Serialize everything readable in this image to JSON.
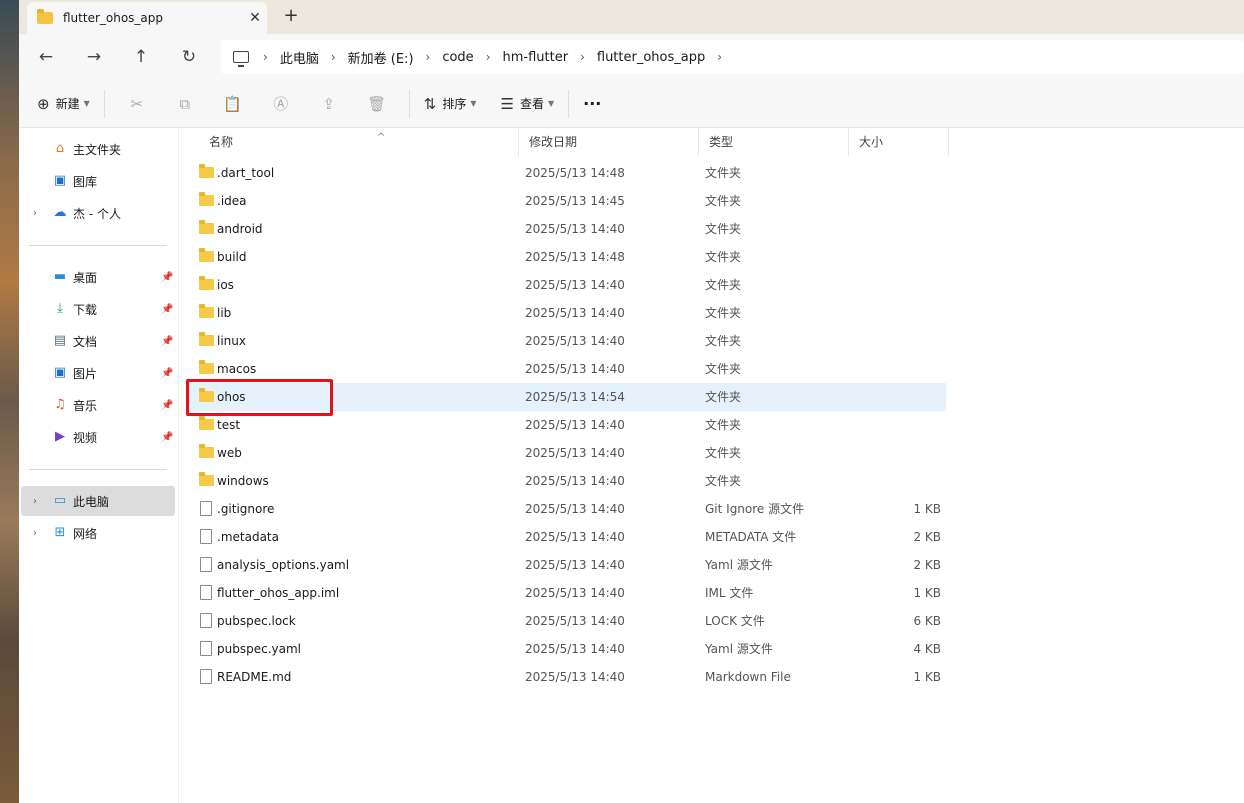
{
  "window": {
    "tab_title": "flutter_ohos_app",
    "close_glyph": "✕",
    "new_tab_glyph": "+"
  },
  "nav": {
    "back_glyph": "←",
    "forward_glyph": "→",
    "up_glyph": "↑",
    "refresh_glyph": "↻",
    "breadcrumbs": [
      "此电脑",
      "新加卷 (E:)",
      "code",
      "hm-flutter",
      "flutter_ohos_app"
    ],
    "separator": "›"
  },
  "toolbar": {
    "new_label": "新建",
    "sort_label": "排序",
    "view_label": "查看",
    "more_glyph": "···"
  },
  "sidebar": {
    "quick": [
      {
        "label": "主文件夹",
        "icon": "home-icon"
      },
      {
        "label": "图库",
        "icon": "gallery-icon"
      },
      {
        "label": "杰 - 个人",
        "icon": "onedrive-icon"
      }
    ],
    "pinned": [
      {
        "label": "桌面",
        "icon": "desktop-icon"
      },
      {
        "label": "下载",
        "icon": "download-icon"
      },
      {
        "label": "文档",
        "icon": "documents-icon"
      },
      {
        "label": "图片",
        "icon": "pictures-icon"
      },
      {
        "label": "音乐",
        "icon": "music-icon"
      },
      {
        "label": "视频",
        "icon": "videos-icon"
      }
    ],
    "locations": [
      {
        "label": "此电脑",
        "icon": "this-pc-icon"
      },
      {
        "label": "网络",
        "icon": "network-icon"
      }
    ]
  },
  "columns": {
    "name": "名称",
    "date": "修改日期",
    "type": "类型",
    "size": "大小"
  },
  "files": [
    {
      "name": ".dart_tool",
      "date": "2025/5/13 14:48",
      "type": "文件夹",
      "size": "",
      "kind": "folder"
    },
    {
      "name": ".idea",
      "date": "2025/5/13 14:45",
      "type": "文件夹",
      "size": "",
      "kind": "folder"
    },
    {
      "name": "android",
      "date": "2025/5/13 14:40",
      "type": "文件夹",
      "size": "",
      "kind": "folder"
    },
    {
      "name": "build",
      "date": "2025/5/13 14:48",
      "type": "文件夹",
      "size": "",
      "kind": "folder"
    },
    {
      "name": "ios",
      "date": "2025/5/13 14:40",
      "type": "文件夹",
      "size": "",
      "kind": "folder"
    },
    {
      "name": "lib",
      "date": "2025/5/13 14:40",
      "type": "文件夹",
      "size": "",
      "kind": "folder"
    },
    {
      "name": "linux",
      "date": "2025/5/13 14:40",
      "type": "文件夹",
      "size": "",
      "kind": "folder"
    },
    {
      "name": "macos",
      "date": "2025/5/13 14:40",
      "type": "文件夹",
      "size": "",
      "kind": "folder"
    },
    {
      "name": "ohos",
      "date": "2025/5/13 14:54",
      "type": "文件夹",
      "size": "",
      "kind": "folder"
    },
    {
      "name": "test",
      "date": "2025/5/13 14:40",
      "type": "文件夹",
      "size": "",
      "kind": "folder"
    },
    {
      "name": "web",
      "date": "2025/5/13 14:40",
      "type": "文件夹",
      "size": "",
      "kind": "folder"
    },
    {
      "name": "windows",
      "date": "2025/5/13 14:40",
      "type": "文件夹",
      "size": "",
      "kind": "folder"
    },
    {
      "name": ".gitignore",
      "date": "2025/5/13 14:40",
      "type": "Git Ignore 源文件",
      "size": "1 KB",
      "kind": "file"
    },
    {
      "name": ".metadata",
      "date": "2025/5/13 14:40",
      "type": "METADATA 文件",
      "size": "2 KB",
      "kind": "file"
    },
    {
      "name": "analysis_options.yaml",
      "date": "2025/5/13 14:40",
      "type": "Yaml 源文件",
      "size": "2 KB",
      "kind": "file"
    },
    {
      "name": "flutter_ohos_app.iml",
      "date": "2025/5/13 14:40",
      "type": "IML 文件",
      "size": "1 KB",
      "kind": "file"
    },
    {
      "name": "pubspec.lock",
      "date": "2025/5/13 14:40",
      "type": "LOCK 文件",
      "size": "6 KB",
      "kind": "file"
    },
    {
      "name": "pubspec.yaml",
      "date": "2025/5/13 14:40",
      "type": "Yaml 源文件",
      "size": "4 KB",
      "kind": "file"
    },
    {
      "name": "README.md",
      "date": "2025/5/13 14:40",
      "type": "Markdown File",
      "size": "1 KB",
      "kind": "file"
    }
  ],
  "selected_index": 8,
  "colors": {
    "selection": "#e5f1fb",
    "highlight": "#e0141e",
    "folder": "#f7c948"
  }
}
